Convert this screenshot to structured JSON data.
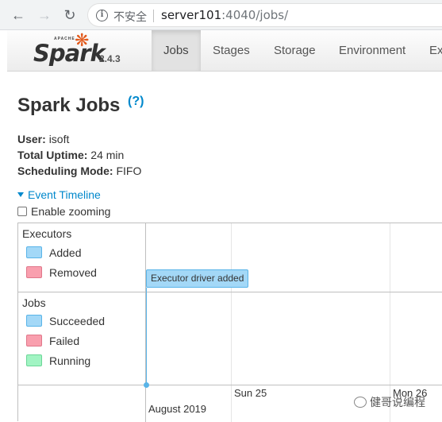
{
  "browser": {
    "back_icon": "arrow-left-icon",
    "forward_icon": "arrow-right-icon",
    "reload_icon": "reload-icon",
    "security_label": "不安全",
    "url_host": "server101",
    "url_rest": ":4040/jobs/"
  },
  "nav": {
    "logo_top": "APACHE",
    "logo_text": "Spark",
    "version": "2.4.3",
    "tabs": [
      "Jobs",
      "Stages",
      "Storage",
      "Environment",
      "Ex"
    ]
  },
  "page": {
    "title": "Spark Jobs",
    "help": "(?)",
    "user_label": "User:",
    "user_value": "isoft",
    "uptime_label": "Total Uptime:",
    "uptime_value": "24 min",
    "sched_label": "Scheduling Mode:",
    "sched_value": "FIFO",
    "timeline_toggle": "Event Timeline",
    "zoom_label": "Enable zooming"
  },
  "timeline": {
    "executors_title": "Executors",
    "executor_legend": [
      {
        "label": "Added",
        "color": "#a3d8f7"
      },
      {
        "label": "Removed",
        "color": "#f99fae"
      }
    ],
    "jobs_title": "Jobs",
    "job_legend": [
      {
        "label": "Succeeded",
        "color": "#a3d8f7"
      },
      {
        "label": "Failed",
        "color": "#f99fae"
      },
      {
        "label": "Running",
        "color": "#a1f4c3"
      }
    ],
    "event_label": "Executor driver added",
    "axis_major": [
      "Sun 25",
      "Mon 26"
    ],
    "axis_month": "August 2019"
  },
  "watermark": {
    "text": "健哥说编程"
  }
}
